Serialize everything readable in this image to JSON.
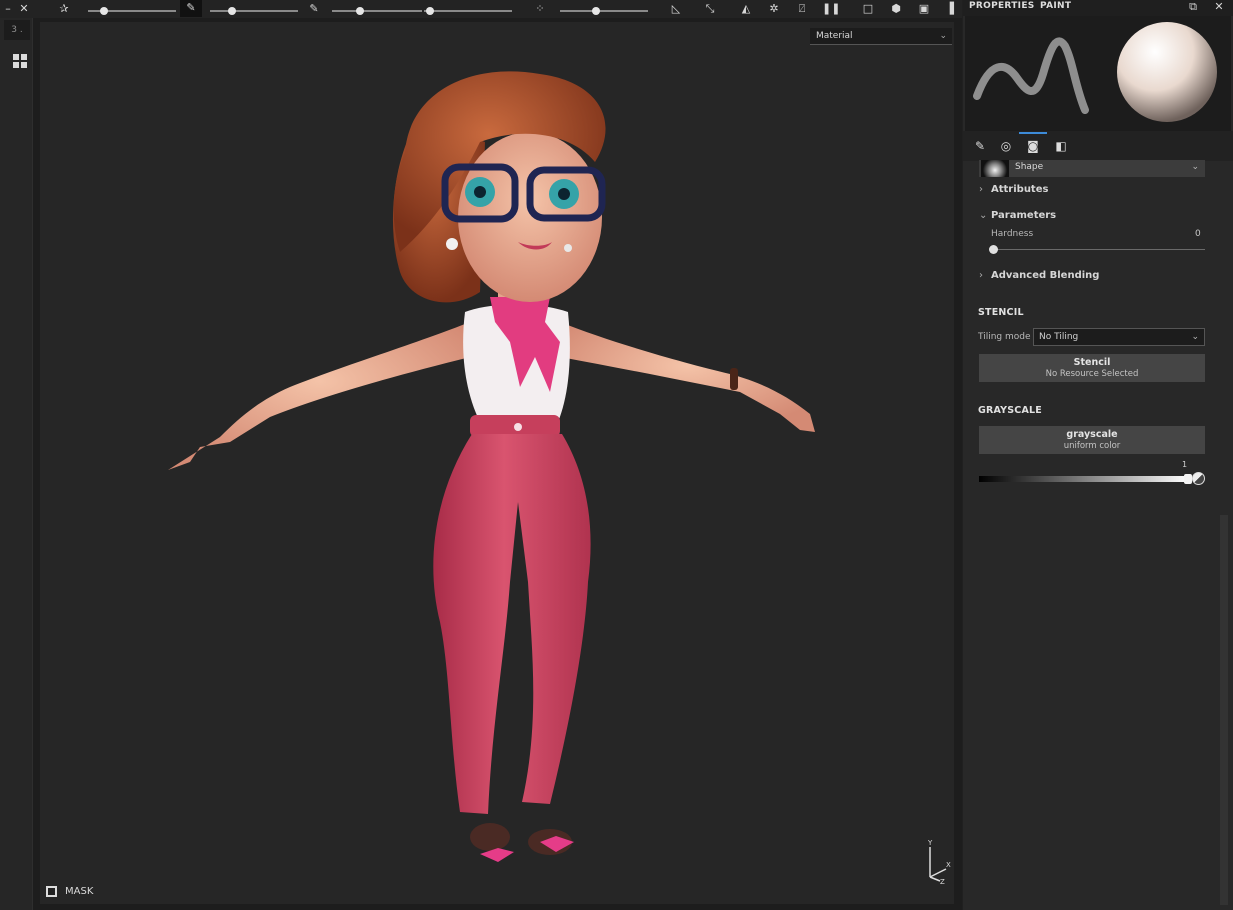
{
  "toolbar": {
    "icons": [
      "pin-icon",
      "brush-icon",
      "smudge-icon",
      "clone-icon",
      "polygon-icon",
      "symmetry-icon",
      "settings-icon",
      "pause-icon",
      "display-icon",
      "camera-icon",
      "render-icon"
    ]
  },
  "left": {
    "tab_label": "3 ."
  },
  "viewport": {
    "material_dropdown": "Material",
    "mask_label": "MASK",
    "axis_y": "Y",
    "axis_x": "X",
    "axis_z": "Z"
  },
  "panel": {
    "tabs": [
      "PROPERTIES",
      "PAINT"
    ],
    "shape_label": "Shape",
    "sections": {
      "attributes": "Attributes",
      "parameters": "Parameters",
      "advanced_blending": "Advanced Blending"
    },
    "hardness": {
      "label": "Hardness",
      "value": "0"
    },
    "stencil": {
      "heading": "STENCIL",
      "tiling_label": "Tiling mode",
      "tiling_value": "No Tiling",
      "resource_title": "Stencil",
      "resource_sub": "No Resource Selected"
    },
    "grayscale": {
      "heading": "GRAYSCALE",
      "resource_title": "grayscale",
      "resource_sub": "uniform color",
      "value": "1"
    }
  },
  "colors": {
    "accent": "#3d8bd8",
    "pants": "#c43e5b",
    "hair": "#8a3d22"
  }
}
